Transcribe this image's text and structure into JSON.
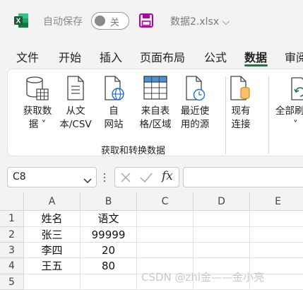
{
  "titlebar": {
    "autosave_label": "自动保存",
    "toggle_state": "关",
    "filename": "数据2.xlsx"
  },
  "tabs": [
    {
      "label": "文件"
    },
    {
      "label": "开始"
    },
    {
      "label": "插入"
    },
    {
      "label": "页面布局"
    },
    {
      "label": "公式"
    },
    {
      "label": "数据",
      "active": true
    },
    {
      "label": "审阅"
    }
  ],
  "ribbon": {
    "buttons": [
      {
        "line1": "获取数",
        "line2": "据 ˅"
      },
      {
        "line1": "从文",
        "line2": "本/CSV"
      },
      {
        "line1": "自",
        "line2": "网站"
      },
      {
        "line1": "来自表",
        "line2": "格/区域"
      },
      {
        "line1": "最近使",
        "line2": "用的源"
      },
      {
        "line1": "现有",
        "line2": "连接"
      },
      {
        "line1": "全部刷",
        "line2": "˅"
      }
    ],
    "group_label": "获取和转换数据"
  },
  "formula_bar": {
    "name_box_value": "C8",
    "fx_label": "fx"
  },
  "sheet": {
    "columns": [
      "A",
      "B",
      "C",
      "D",
      "E"
    ],
    "rows": [
      "1",
      "2",
      "3",
      "4",
      "5"
    ],
    "cells": [
      [
        "姓名",
        "语文",
        "",
        "",
        ""
      ],
      [
        "张三",
        "99999",
        "",
        "",
        ""
      ],
      [
        "李四",
        "20",
        "",
        "",
        ""
      ],
      [
        "王五",
        "80",
        "",
        "",
        ""
      ],
      [
        "",
        "",
        "",
        "",
        ""
      ]
    ]
  },
  "watermark": "CSDN @zhi金——金小亮",
  "colors": {
    "accent": "#217346",
    "save_icon": "#b4009e"
  }
}
